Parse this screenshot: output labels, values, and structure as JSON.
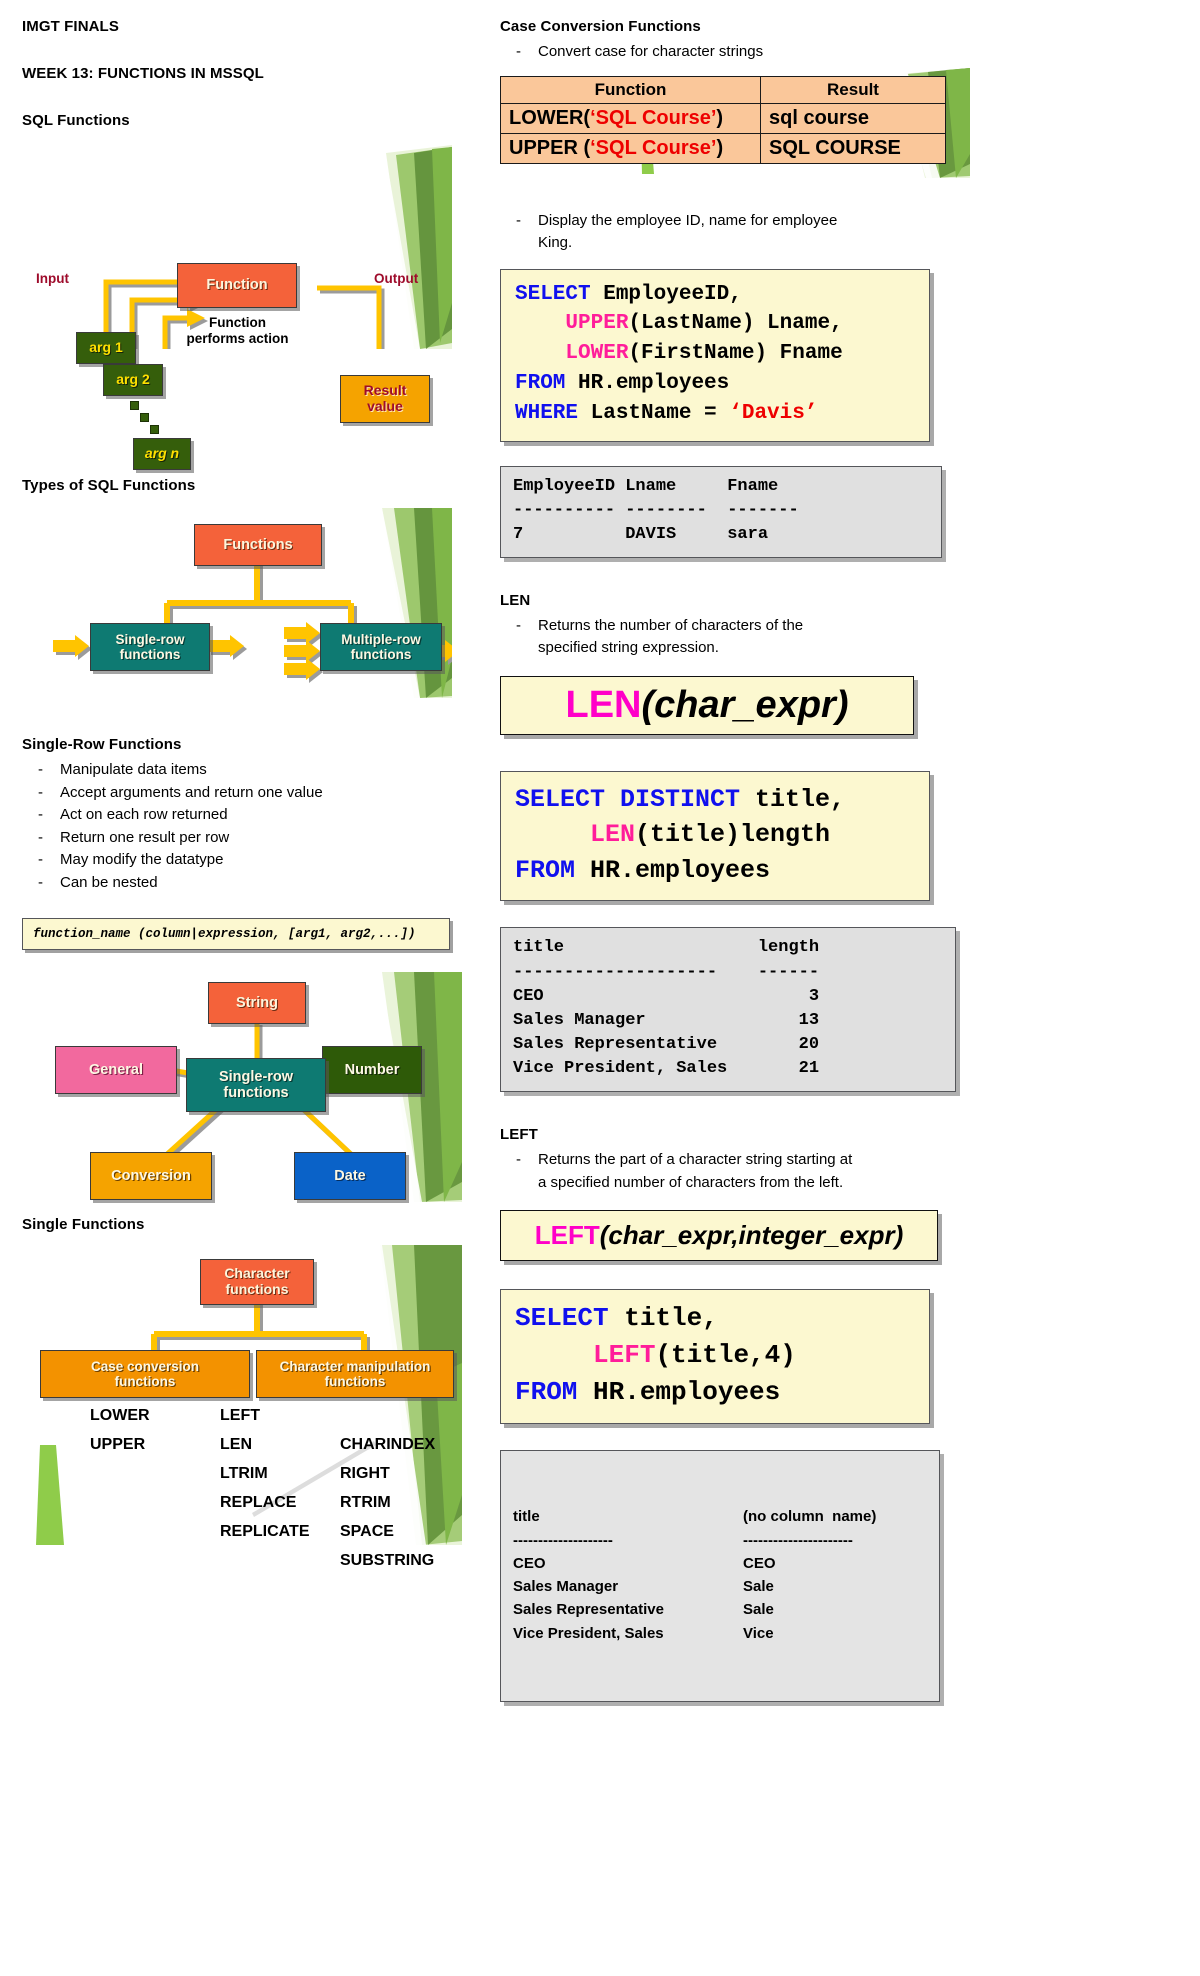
{
  "header": {
    "course": "IMGT FINALS",
    "week": "WEEK 13: FUNCTIONS IN MSSQL"
  },
  "left": {
    "sec_sql_functions": "SQL Functions",
    "diagram_sql_functions": {
      "input_label": "Input",
      "output_label": "Output",
      "function_box": "Function",
      "caption_line1": "Function",
      "caption_line2": "performs action",
      "arg1": "arg 1",
      "arg2": "arg 2",
      "argn": "arg n",
      "result_line1": "Result",
      "result_line2": "value"
    },
    "sec_types": "Types of SQL Functions",
    "diagram_types": {
      "root": "Functions",
      "left_line1": "Single-row",
      "left_line2": "functions",
      "right_line1": "Multiple-row",
      "right_line2": "functions"
    },
    "sec_single_row": "Single-Row Functions",
    "single_row_bullets": [
      "Manipulate data items",
      "Accept arguments and return one value",
      "Act on each row returned",
      "Return one result per row",
      "May modify the datatype",
      "Can be nested"
    ],
    "syntax_box": "function_name (column|expression, [arg1, arg2,...])",
    "diagram_radial": {
      "center_line1": "Single-row",
      "center_line2": "functions",
      "top": "String",
      "left": "General",
      "right": "Number",
      "bottom_left": "Conversion",
      "bottom_right": "Date"
    },
    "sec_single_functions": "Single Functions",
    "diagram_character": {
      "root_line1": "Character",
      "root_line2": "functions",
      "left_line1": "Case conversion",
      "left_line2": "functions",
      "right_line1": "Character manipulation",
      "right_line2": "functions",
      "case_list": [
        "LOWER",
        "UPPER"
      ],
      "manip_list_col1": [
        "LEFT",
        "LEN",
        "LTRIM",
        "REPLACE",
        "REPLICATE"
      ],
      "manip_list_col2": [
        "CHARINDEX",
        "RIGHT",
        "RTRIM",
        "SPACE",
        "SUBSTRING"
      ]
    }
  },
  "right": {
    "sec_case_conversion": "Case Conversion Functions",
    "case_conversion_bullet": "Convert case for character strings",
    "case_table": {
      "headers": [
        "Function",
        "Result"
      ],
      "rows": [
        {
          "fn_pre": "LOWER(",
          "fn_arg": "‘SQL Course’",
          "fn_post": ")",
          "result": "sql course"
        },
        {
          "fn_pre": "UPPER (",
          "fn_arg": "‘SQL Course’",
          "fn_post": ")",
          "result": "SQL COURSE"
        }
      ]
    },
    "display_bullet_line1": "Display the employee ID, name for employee",
    "display_bullet_line2": "King.",
    "code_upper_lower": {
      "lines": [
        [
          {
            "t": "SELECT",
            "c": "kw"
          },
          {
            "t": " EmployeeID,",
            "c": ""
          }
        ],
        [
          {
            "t": "    ",
            "c": ""
          },
          {
            "t": "UPPER",
            "c": "fn"
          },
          {
            "t": "(LastName) Lname,",
            "c": ""
          }
        ],
        [
          {
            "t": "    ",
            "c": ""
          },
          {
            "t": "LOWER",
            "c": "fn"
          },
          {
            "t": "(FirstName) Fname",
            "c": ""
          }
        ],
        [
          {
            "t": "FROM",
            "c": "kw"
          },
          {
            "t": " HR.employees",
            "c": ""
          }
        ],
        [
          {
            "t": "WHERE",
            "c": "kw"
          },
          {
            "t": " LastName = ",
            "c": ""
          },
          {
            "t": "‘Davis’",
            "c": "str"
          }
        ]
      ]
    },
    "result_upper_lower": "EmployeeID Lname     Fname\n---------- --------  -------\n7          DAVIS     sara",
    "sec_len": "LEN",
    "len_bullet_line1": "Returns the number of characters of the",
    "len_bullet_line2": "specified string expression.",
    "len_signature": {
      "fn": "LEN",
      "open": "(",
      "arg": "char_expr",
      "close": ")"
    },
    "code_len": {
      "lines": [
        [
          {
            "t": "SELECT DISTINCT",
            "c": "kw"
          },
          {
            "t": " title,",
            "c": ""
          }
        ],
        [
          {
            "t": "     ",
            "c": ""
          },
          {
            "t": "LEN",
            "c": "fn"
          },
          {
            "t": "(title)length",
            "c": ""
          }
        ],
        [
          {
            "t": "FROM",
            "c": "kw"
          },
          {
            "t": " HR.employees",
            "c": ""
          }
        ]
      ]
    },
    "result_len": "title                   length\n--------------------    ------\nCEO                          3\nSales Manager               13\nSales Representative        20\nVice President, Sales       21",
    "sec_left": "LEFT",
    "left_bullet_line1": "Returns the part of a character string starting at",
    "left_bullet_line2": "a specified number of characters from the left.",
    "left_signature": {
      "fn": "LEFT",
      "open": "(",
      "arg": "char_expr,integer_expr",
      "close": ")"
    },
    "code_left": {
      "lines": [
        [
          {
            "t": "SELECT",
            "c": "kw"
          },
          {
            "t": " title,",
            "c": ""
          }
        ],
        [
          {
            "t": "     ",
            "c": ""
          },
          {
            "t": "LEFT",
            "c": "fn"
          },
          {
            "t": "(title,4)",
            "c": ""
          }
        ],
        [
          {
            "t": "FROM",
            "c": "kw"
          },
          {
            "t": " HR.employees",
            "c": ""
          }
        ]
      ]
    },
    "result_left": {
      "headers": [
        "title",
        "(no column  name)"
      ],
      "rules": [
        "--------------------",
        "----------------------"
      ],
      "rows": [
        [
          "CEO",
          "CEO"
        ],
        [
          "Sales Manager",
          "Sale"
        ],
        [
          "Sales Representative",
          "Sale"
        ],
        [
          "Vice President, Sales",
          "Vice"
        ]
      ]
    }
  }
}
